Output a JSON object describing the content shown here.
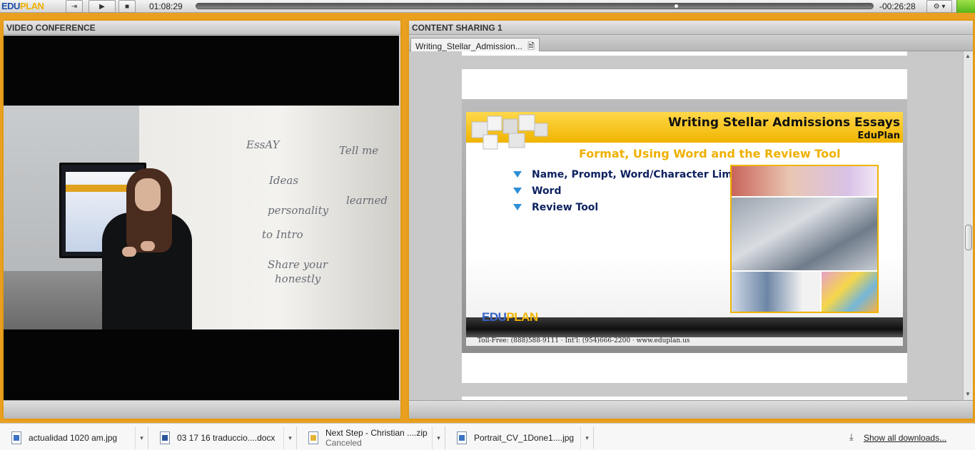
{
  "app": {
    "logo_part1": "EDU",
    "logo_part2": "PLAN"
  },
  "player": {
    "elapsed": "01:08:29",
    "remaining": "-00:26:28",
    "progress_fraction": 0.71,
    "settings_icon": "gear-icon"
  },
  "video_panel": {
    "title": "VIDEO CONFERENCE"
  },
  "content_panel": {
    "title": "CONTENT SHARING 1",
    "document_tab": "Writing_Stellar_Admission...",
    "slide": {
      "title": "Writing Stellar Admissions Essays",
      "brand": "EduPlan",
      "subtitle": "Format, Using Word and the Review Tool",
      "bullets": [
        "Name, Prompt, Word/Character Limit",
        "Word",
        "Review Tool"
      ],
      "footer_logo_part1": "EDU",
      "footer_logo_part2": "PLAN",
      "contact": "Toll-Free: (888)588-9111 · Int'l: (954)666-2200 · www.eduplan.us"
    }
  },
  "downloads": {
    "items": [
      {
        "name": "actualidad 1020 am.jpg",
        "status": "",
        "icon": "image-file-icon"
      },
      {
        "name": "03 17 16 traduccio....docx",
        "status": "",
        "icon": "word-document-icon"
      },
      {
        "name": "Next Step - Christian ....zip",
        "status": "Canceled",
        "icon": "zip-file-icon"
      },
      {
        "name": "Portrait_CV_1Done1....jpg",
        "status": "",
        "icon": "image-file-icon"
      }
    ],
    "show_all": "Show all downloads..."
  },
  "colors": {
    "accent": "#e39a16",
    "brand_blue": "#1f4fa8",
    "brand_yellow": "#f0b000"
  }
}
